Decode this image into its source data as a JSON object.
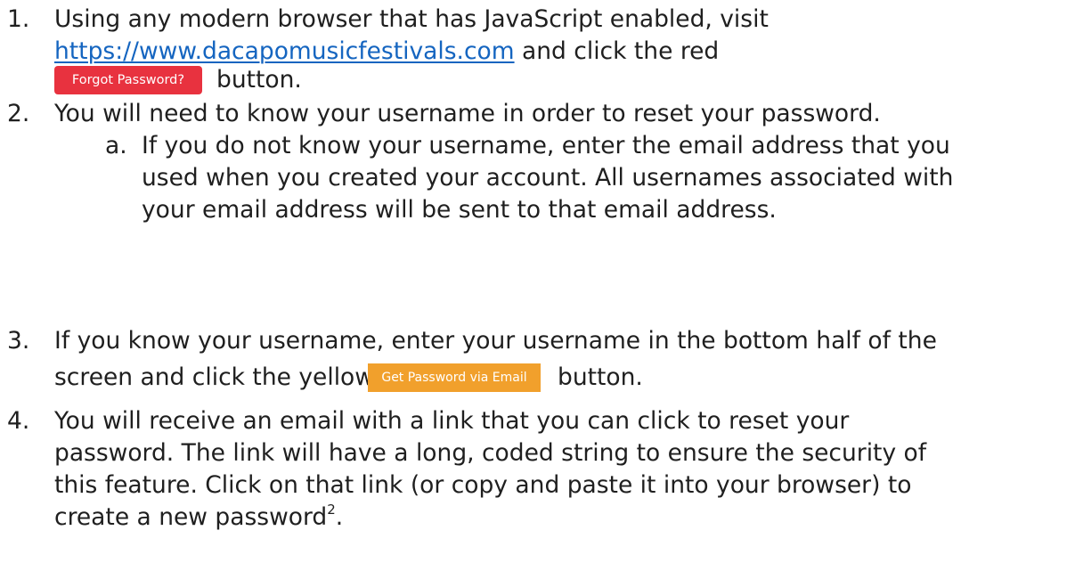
{
  "steps": {
    "s1": {
      "num": "1.",
      "l1": "Using any modern browser that has JavaScript enabled, visit",
      "link": "https://www.dacapomusicfestivals.com",
      "l2_tail": " and click the red",
      "btn": "Forgot Password?",
      "l3_tail": "button."
    },
    "s2": {
      "num": "2.",
      "l1": "You will need to know your username in order to reset your password.",
      "a_num": "a.",
      "a_l1": "If you do not know your username, enter the email address that you",
      "a_l2": "used when you created your account.  All usernames associated with",
      "a_l3": "your email address will be sent to that email address."
    },
    "s3": {
      "num": "3.",
      "l1": "If you know your username, enter your username in the bottom half of the",
      "l2_head": "screen and click the yellow",
      "btn": "Get Password via Email",
      "l2_tail": "button."
    },
    "s4": {
      "num": "4.",
      "l1": "You will receive an email with a link that you can click to reset your",
      "l2": "password.  The link will have a long, coded string to ensure the security of",
      "l3": "this feature.  Click on that link (or copy and paste it into your browser) to",
      "l4": "create a new password",
      "footnote": "2",
      "l4_end": "."
    }
  },
  "colors": {
    "link": "#1565c0",
    "red_button": "#e8323f",
    "yellow_button": "#f1a02c"
  }
}
